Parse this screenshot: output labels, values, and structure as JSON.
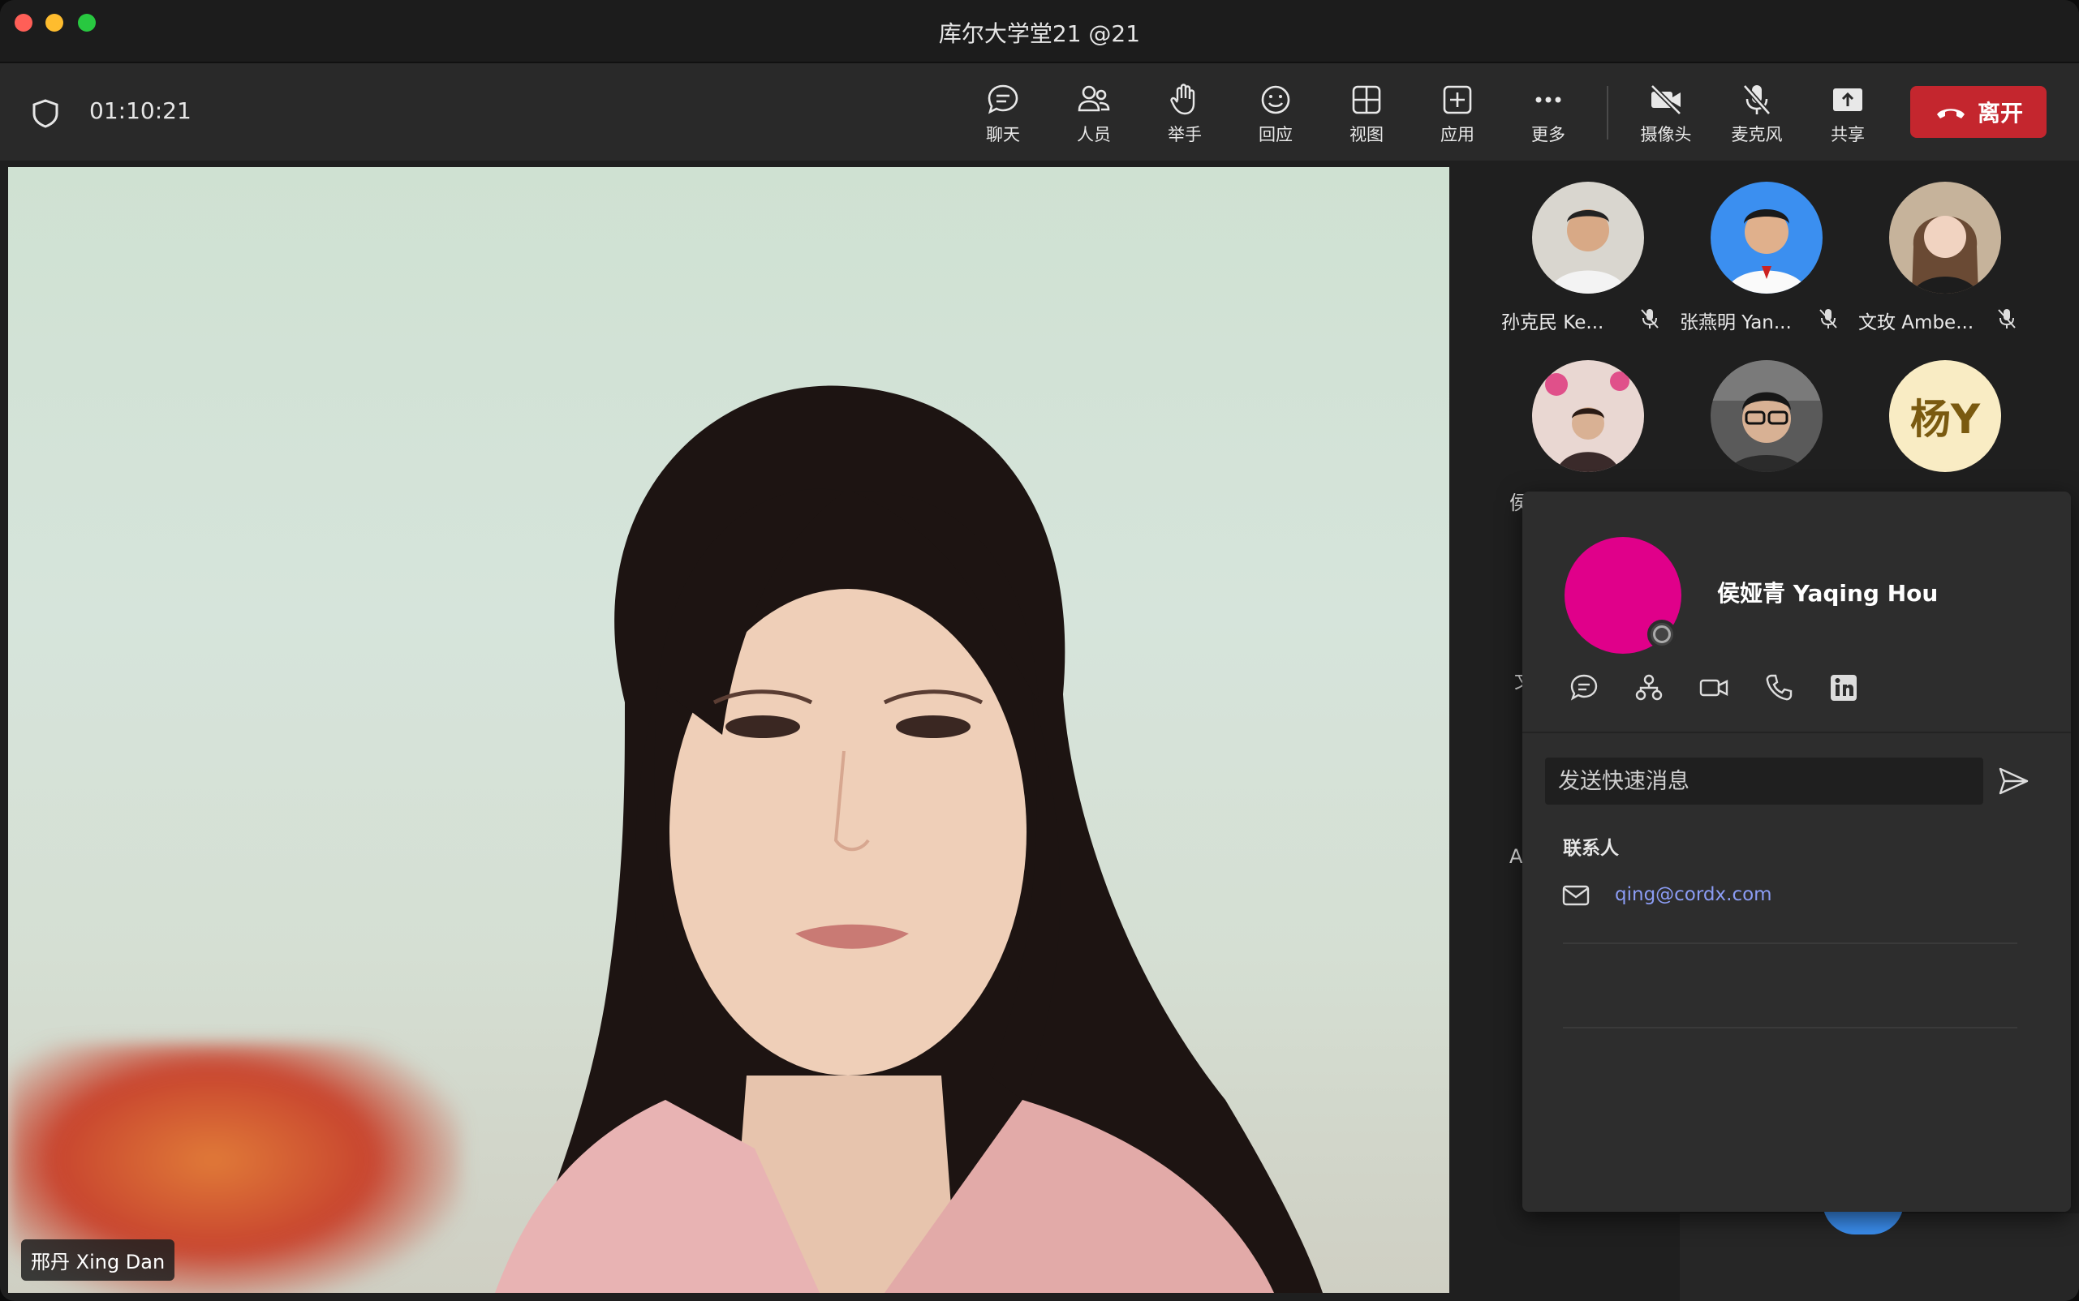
{
  "window": {
    "title": "库尔大学堂21 @21"
  },
  "toolbar": {
    "timer": "01:10:21",
    "buttons": [
      {
        "id": "chat",
        "label": "聊天",
        "icon": "chat-icon"
      },
      {
        "id": "people",
        "label": "人员",
        "icon": "people-icon"
      },
      {
        "id": "raise",
        "label": "举手",
        "icon": "raise-hand-icon"
      },
      {
        "id": "react",
        "label": "回应",
        "icon": "smiley-icon"
      },
      {
        "id": "view",
        "label": "视图",
        "icon": "grid-view-icon"
      },
      {
        "id": "apps",
        "label": "应用",
        "icon": "add-app-icon"
      },
      {
        "id": "more",
        "label": "更多",
        "icon": "more-icon"
      },
      {
        "id": "camera",
        "label": "摄像头",
        "icon": "camera-off-icon"
      },
      {
        "id": "mic",
        "label": "麦克风",
        "icon": "mic-off-icon"
      },
      {
        "id": "share",
        "label": "共享",
        "icon": "share-icon"
      }
    ],
    "leave_label": "离开",
    "colors": {
      "leave_bg": "#c4262e",
      "toolbar_bg": "#292929"
    }
  },
  "main_video": {
    "participant_name": "邢丹 Xing Dan"
  },
  "gallery": {
    "participants": [
      {
        "name": "孙克民 Ke...",
        "muted": true
      },
      {
        "name": "张燕明 Yan...",
        "muted": true
      },
      {
        "name": "文玫 Ambe...",
        "muted": true
      },
      {
        "name": "",
        "muted": false
      },
      {
        "name": "",
        "muted": false
      },
      {
        "name": "",
        "initials": "杨Y",
        "muted": false
      }
    ],
    "partial_labels": [
      "侯",
      "文",
      "A"
    ]
  },
  "contact_card": {
    "name": "侯娅青 Yaqing Hou",
    "avatar_color": "#e0008a",
    "actions": [
      "chat-icon",
      "org-chart-icon",
      "video-call-icon",
      "phone-icon",
      "linkedin-icon"
    ],
    "quick_message_placeholder": "发送快速消息",
    "contacts_heading": "联系人",
    "email": "qing@cordx.com"
  }
}
